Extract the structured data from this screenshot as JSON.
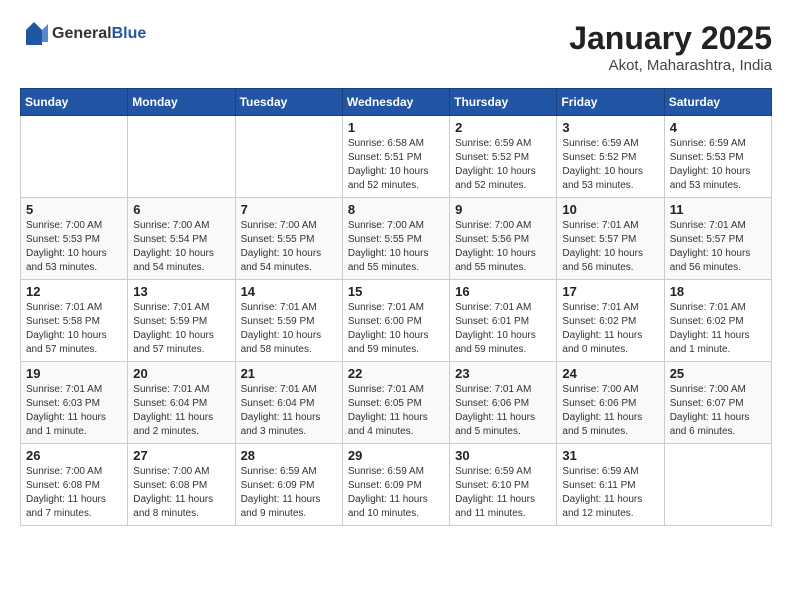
{
  "header": {
    "logo_general": "General",
    "logo_blue": "Blue",
    "title": "January 2025",
    "subtitle": "Akot, Maharashtra, India"
  },
  "weekdays": [
    "Sunday",
    "Monday",
    "Tuesday",
    "Wednesday",
    "Thursday",
    "Friday",
    "Saturday"
  ],
  "weeks": [
    [
      {
        "day": "",
        "info": ""
      },
      {
        "day": "",
        "info": ""
      },
      {
        "day": "",
        "info": ""
      },
      {
        "day": "1",
        "info": "Sunrise: 6:58 AM\nSunset: 5:51 PM\nDaylight: 10 hours and 52 minutes."
      },
      {
        "day": "2",
        "info": "Sunrise: 6:59 AM\nSunset: 5:52 PM\nDaylight: 10 hours and 52 minutes."
      },
      {
        "day": "3",
        "info": "Sunrise: 6:59 AM\nSunset: 5:52 PM\nDaylight: 10 hours and 53 minutes."
      },
      {
        "day": "4",
        "info": "Sunrise: 6:59 AM\nSunset: 5:53 PM\nDaylight: 10 hours and 53 minutes."
      }
    ],
    [
      {
        "day": "5",
        "info": "Sunrise: 7:00 AM\nSunset: 5:53 PM\nDaylight: 10 hours and 53 minutes."
      },
      {
        "day": "6",
        "info": "Sunrise: 7:00 AM\nSunset: 5:54 PM\nDaylight: 10 hours and 54 minutes."
      },
      {
        "day": "7",
        "info": "Sunrise: 7:00 AM\nSunset: 5:55 PM\nDaylight: 10 hours and 54 minutes."
      },
      {
        "day": "8",
        "info": "Sunrise: 7:00 AM\nSunset: 5:55 PM\nDaylight: 10 hours and 55 minutes."
      },
      {
        "day": "9",
        "info": "Sunrise: 7:00 AM\nSunset: 5:56 PM\nDaylight: 10 hours and 55 minutes."
      },
      {
        "day": "10",
        "info": "Sunrise: 7:01 AM\nSunset: 5:57 PM\nDaylight: 10 hours and 56 minutes."
      },
      {
        "day": "11",
        "info": "Sunrise: 7:01 AM\nSunset: 5:57 PM\nDaylight: 10 hours and 56 minutes."
      }
    ],
    [
      {
        "day": "12",
        "info": "Sunrise: 7:01 AM\nSunset: 5:58 PM\nDaylight: 10 hours and 57 minutes."
      },
      {
        "day": "13",
        "info": "Sunrise: 7:01 AM\nSunset: 5:59 PM\nDaylight: 10 hours and 57 minutes."
      },
      {
        "day": "14",
        "info": "Sunrise: 7:01 AM\nSunset: 5:59 PM\nDaylight: 10 hours and 58 minutes."
      },
      {
        "day": "15",
        "info": "Sunrise: 7:01 AM\nSunset: 6:00 PM\nDaylight: 10 hours and 59 minutes."
      },
      {
        "day": "16",
        "info": "Sunrise: 7:01 AM\nSunset: 6:01 PM\nDaylight: 10 hours and 59 minutes."
      },
      {
        "day": "17",
        "info": "Sunrise: 7:01 AM\nSunset: 6:02 PM\nDaylight: 11 hours and 0 minutes."
      },
      {
        "day": "18",
        "info": "Sunrise: 7:01 AM\nSunset: 6:02 PM\nDaylight: 11 hours and 1 minute."
      }
    ],
    [
      {
        "day": "19",
        "info": "Sunrise: 7:01 AM\nSunset: 6:03 PM\nDaylight: 11 hours and 1 minute."
      },
      {
        "day": "20",
        "info": "Sunrise: 7:01 AM\nSunset: 6:04 PM\nDaylight: 11 hours and 2 minutes."
      },
      {
        "day": "21",
        "info": "Sunrise: 7:01 AM\nSunset: 6:04 PM\nDaylight: 11 hours and 3 minutes."
      },
      {
        "day": "22",
        "info": "Sunrise: 7:01 AM\nSunset: 6:05 PM\nDaylight: 11 hours and 4 minutes."
      },
      {
        "day": "23",
        "info": "Sunrise: 7:01 AM\nSunset: 6:06 PM\nDaylight: 11 hours and 5 minutes."
      },
      {
        "day": "24",
        "info": "Sunrise: 7:00 AM\nSunset: 6:06 PM\nDaylight: 11 hours and 5 minutes."
      },
      {
        "day": "25",
        "info": "Sunrise: 7:00 AM\nSunset: 6:07 PM\nDaylight: 11 hours and 6 minutes."
      }
    ],
    [
      {
        "day": "26",
        "info": "Sunrise: 7:00 AM\nSunset: 6:08 PM\nDaylight: 11 hours and 7 minutes."
      },
      {
        "day": "27",
        "info": "Sunrise: 7:00 AM\nSunset: 6:08 PM\nDaylight: 11 hours and 8 minutes."
      },
      {
        "day": "28",
        "info": "Sunrise: 6:59 AM\nSunset: 6:09 PM\nDaylight: 11 hours and 9 minutes."
      },
      {
        "day": "29",
        "info": "Sunrise: 6:59 AM\nSunset: 6:09 PM\nDaylight: 11 hours and 10 minutes."
      },
      {
        "day": "30",
        "info": "Sunrise: 6:59 AM\nSunset: 6:10 PM\nDaylight: 11 hours and 11 minutes."
      },
      {
        "day": "31",
        "info": "Sunrise: 6:59 AM\nSunset: 6:11 PM\nDaylight: 11 hours and 12 minutes."
      },
      {
        "day": "",
        "info": ""
      }
    ]
  ]
}
